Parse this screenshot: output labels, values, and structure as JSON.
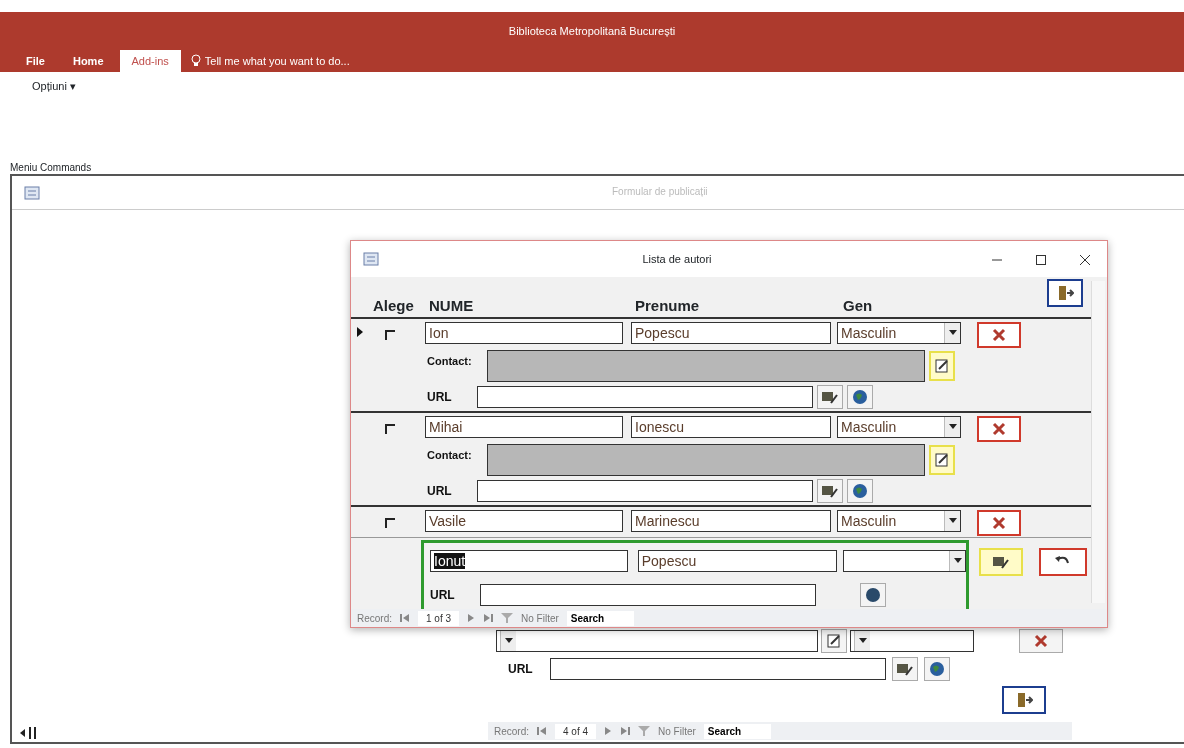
{
  "app": {
    "title": "Biblioteca Metropolitană București",
    "tabs": [
      {
        "label": "File",
        "selected": false
      },
      {
        "label": "Home",
        "selected": false
      },
      {
        "label": "Add-ins",
        "selected": true
      }
    ],
    "tell_me": "Tell me what you want to do...",
    "ribbon_button": "Opțiuni ▾"
  },
  "menu_label": "Meniu Commands",
  "main_form": {
    "title": "Formular de publicații"
  },
  "back_subform": {
    "url_label": "URL",
    "record_nav": {
      "label": "Record:",
      "position": "4 of 4",
      "filter": "No Filter",
      "search": "Search"
    }
  },
  "dialog": {
    "title": "Lista de autori",
    "columns": [
      "Alege",
      "NUME",
      "Prenume",
      "Gen"
    ],
    "rows": [
      {
        "nume": "Ion",
        "prenume": "Popescu",
        "gen": "Masculin",
        "checked": false,
        "current": true,
        "contact_label": "Contact:",
        "url_label": "URL"
      },
      {
        "nume": "Mihai",
        "prenume": "Ionescu",
        "gen": "Masculin",
        "checked": false,
        "current": false,
        "contact_label": "Contact:",
        "url_label": "URL"
      },
      {
        "nume": "Vasile",
        "prenume": "Marinescu",
        "gen": "Masculin",
        "checked": false,
        "current": false
      }
    ],
    "new_row": {
      "nume": "Ionut",
      "prenume": "Popescu",
      "url_label": "URL"
    },
    "record_nav": {
      "label": "Record:",
      "position": "1 of 3",
      "filter": "No Filter",
      "search": "Search"
    }
  }
}
